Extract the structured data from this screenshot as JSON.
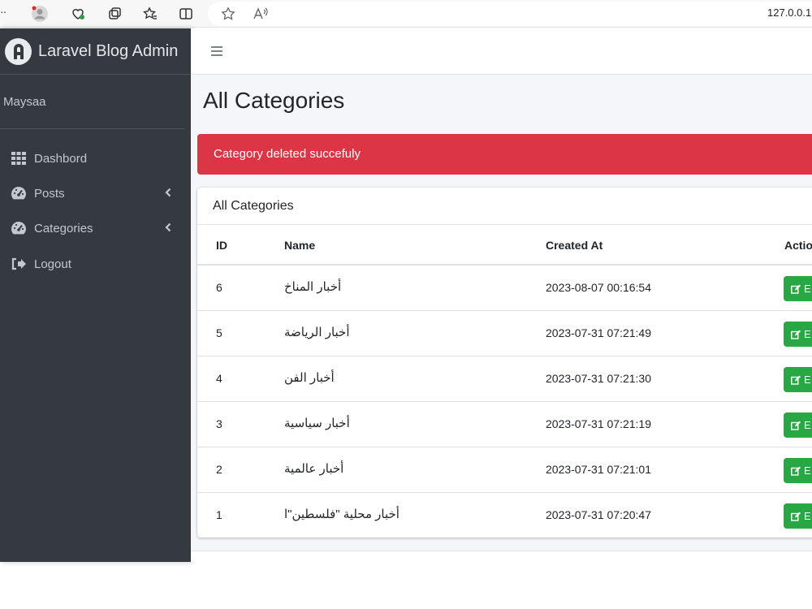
{
  "browser": {
    "url": "127.0.0.1"
  },
  "brand": {
    "name": "Laravel Blog Admin"
  },
  "user": {
    "name": "Maysaa"
  },
  "sidebar": {
    "items": [
      {
        "label": "Dashbord",
        "icon": "grid-icon"
      },
      {
        "label": "Posts",
        "icon": "tachometer-icon"
      },
      {
        "label": "Categories",
        "icon": "tachometer-icon"
      },
      {
        "label": "Logout",
        "icon": "sign-out-icon"
      }
    ]
  },
  "page": {
    "title": "All Categories"
  },
  "alert": {
    "message": "Category deleted succefuly"
  },
  "card": {
    "title": "All Categories"
  },
  "table": {
    "headers": [
      "ID",
      "Name",
      "Created At",
      "Actio"
    ],
    "rows": [
      {
        "id": "6",
        "name": "أخبار المناخ",
        "created_at": "2023-08-07 00:16:54",
        "action": "E"
      },
      {
        "id": "5",
        "name": "أخبار الرياضة",
        "created_at": "2023-07-31 07:21:49",
        "action": "E"
      },
      {
        "id": "4",
        "name": "أخبار الفن",
        "created_at": "2023-07-31 07:21:30",
        "action": "E"
      },
      {
        "id": "3",
        "name": "أخبار سياسية",
        "created_at": "2023-07-31 07:21:19",
        "action": "E"
      },
      {
        "id": "2",
        "name": "أخبار عالمية",
        "created_at": "2023-07-31 07:21:01",
        "action": "E"
      },
      {
        "id": "1",
        "name": "أخبار محلية \"فلسطين\"ا",
        "created_at": "2023-07-31 07:20:47",
        "action": "E"
      }
    ]
  },
  "colors": {
    "sidebar_bg": "#343a40",
    "alert_danger": "#dc3545",
    "edit_button": "#28a745",
    "content_bg": "#f4f6f9"
  }
}
